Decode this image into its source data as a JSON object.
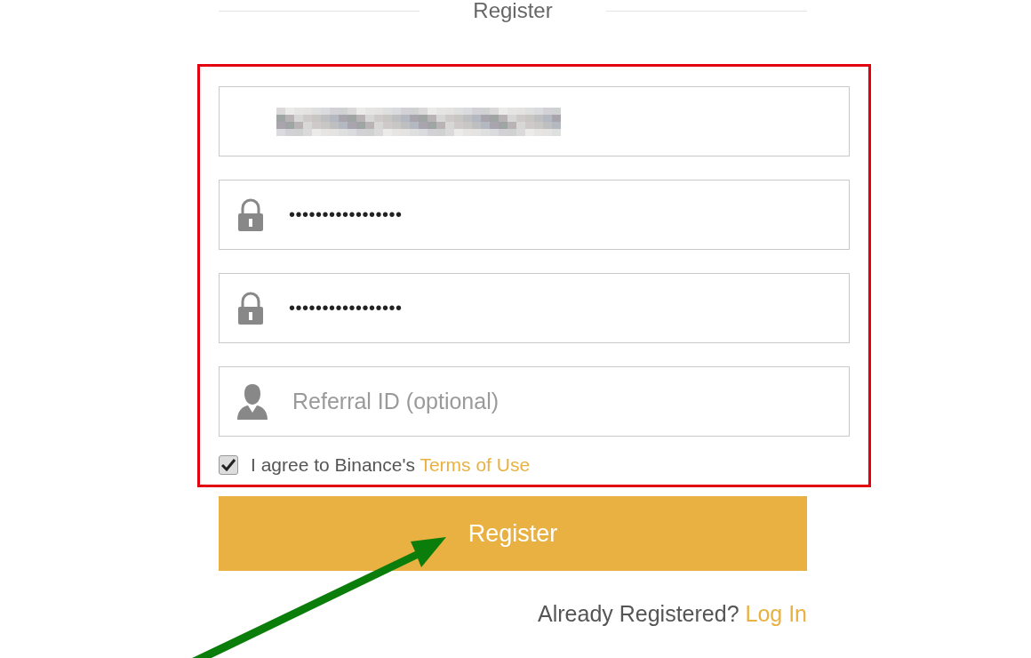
{
  "title": "Register",
  "fields": [
    {
      "kind": "email",
      "blurred": true
    },
    {
      "kind": "password",
      "value": "•••••••••••••••••"
    },
    {
      "kind": "password",
      "value": "•••••••••••••••••"
    },
    {
      "kind": "referral",
      "placeholder": "Referral ID (optional)"
    }
  ],
  "agreement": {
    "checked": true,
    "text": "I agree to Binance's",
    "link": "Terms of Use"
  },
  "register_button": "Register",
  "login": {
    "text": "Already Registered?",
    "link": "Log In"
  }
}
